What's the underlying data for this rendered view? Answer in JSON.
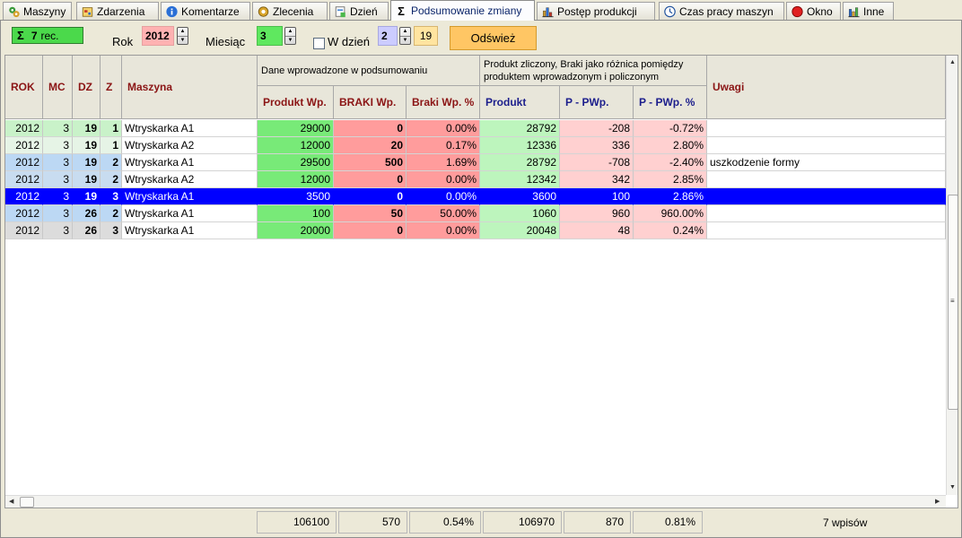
{
  "tabs": [
    {
      "label": "Maszyny",
      "icon": "machines-icon"
    },
    {
      "label": "Zdarzenia",
      "icon": "events-icon"
    },
    {
      "label": "Komentarze",
      "icon": "info-icon"
    },
    {
      "label": "Zlecenia",
      "icon": "gear-icon"
    },
    {
      "label": "Dzień",
      "icon": "day-icon"
    },
    {
      "label": "Podsumowanie zmiany",
      "icon": "sigma-icon",
      "active": true
    },
    {
      "label": "Postęp produkcji",
      "icon": "bar-chart-icon"
    },
    {
      "label": "Czas pracy maszyn",
      "icon": "clock-icon"
    },
    {
      "label": "Okno",
      "icon": "red-circle-icon"
    },
    {
      "label": "Inne",
      "icon": "bar-chart-icon"
    }
  ],
  "toolbar": {
    "record_sigma": "Σ",
    "record_count": "7",
    "record_suffix": "rec.",
    "year_label": "Rok",
    "year_value": "2012",
    "month_label": "Miesiąc",
    "month_value": "3",
    "day_checkbox_label": "W dzień",
    "day_value": "2",
    "day_display": "19",
    "refresh_label": "Odśwież"
  },
  "grid": {
    "headers": {
      "rok": "ROK",
      "mc": "MC",
      "dz": "DZ",
      "z": "Z",
      "maszyna": "Maszyna",
      "group1": "Dane wprowadzone w podsumowaniu",
      "produkt_wp": "Produkt Wp.",
      "braki_wp": "BRAKI Wp.",
      "braki_wp_pct": "Braki Wp. %",
      "group2": "Produkt zliczony, Braki jako różnica pomiędzy produktem wprowadzonym i policzonym",
      "produkt": "Produkt",
      "p_pwp": "P - PWp.",
      "p_pwp_pct": "P - PWp. %",
      "uwagi": "Uwagi"
    },
    "rows": [
      {
        "rok": "2012",
        "mc": "3",
        "dz": "19",
        "z": "1",
        "maszyna": "Wtryskarka A1",
        "produkt_wp": "29000",
        "braki_wp": "0",
        "braki_wp_pct": "0.00%",
        "produkt": "28792",
        "p_pwp": "-208",
        "p_pwp_pct": "-0.72%",
        "uwagi": ""
      },
      {
        "rok": "2012",
        "mc": "3",
        "dz": "19",
        "z": "1",
        "maszyna": "Wtryskarka A2",
        "produkt_wp": "12000",
        "braki_wp": "20",
        "braki_wp_pct": "0.17%",
        "produkt": "12336",
        "p_pwp": "336",
        "p_pwp_pct": "2.80%",
        "uwagi": ""
      },
      {
        "rok": "2012",
        "mc": "3",
        "dz": "19",
        "z": "2",
        "maszyna": "Wtryskarka A1",
        "produkt_wp": "29500",
        "braki_wp": "500",
        "braki_wp_pct": "1.69%",
        "produkt": "28792",
        "p_pwp": "-708",
        "p_pwp_pct": "-2.40%",
        "uwagi": "uszkodzenie formy"
      },
      {
        "rok": "2012",
        "mc": "3",
        "dz": "19",
        "z": "2",
        "maszyna": "Wtryskarka A2",
        "produkt_wp": "12000",
        "braki_wp": "0",
        "braki_wp_pct": "0.00%",
        "produkt": "12342",
        "p_pwp": "342",
        "p_pwp_pct": "2.85%",
        "uwagi": ""
      },
      {
        "rok": "2012",
        "mc": "3",
        "dz": "19",
        "z": "3",
        "maszyna": "Wtryskarka A1",
        "produkt_wp": "3500",
        "braki_wp": "0",
        "braki_wp_pct": "0.00%",
        "produkt": "3600",
        "p_pwp": "100",
        "p_pwp_pct": "2.86%",
        "uwagi": "",
        "selected": true
      },
      {
        "rok": "2012",
        "mc": "3",
        "dz": "26",
        "z": "2",
        "maszyna": "Wtryskarka A1",
        "produkt_wp": "100",
        "braki_wp": "50",
        "braki_wp_pct": "50.00%",
        "produkt": "1060",
        "p_pwp": "960",
        "p_pwp_pct": "960.00%",
        "uwagi": ""
      },
      {
        "rok": "2012",
        "mc": "3",
        "dz": "26",
        "z": "3",
        "maszyna": "Wtryskarka A1",
        "produkt_wp": "20000",
        "braki_wp": "0",
        "braki_wp_pct": "0.00%",
        "produkt": "20048",
        "p_pwp": "48",
        "p_pwp_pct": "0.24%",
        "uwagi": ""
      }
    ]
  },
  "footer": {
    "produkt_wp_sum": "106100",
    "braki_wp_sum": "570",
    "braki_wp_pct": "0.54%",
    "produkt_sum": "106970",
    "p_pwp_sum": "870",
    "p_pwp_pct": "0.81%",
    "count": "7 wpisów"
  },
  "colors": {
    "selected_row": "#0000ff",
    "produkt_wp_bg": "#78ea78",
    "braki_bg": "#ff9c9c",
    "produkt_bg": "#bdf5bd",
    "diff_bg": "#ffd0d0",
    "header_red": "#8b1515",
    "header_blue": "#1c1e8c"
  }
}
